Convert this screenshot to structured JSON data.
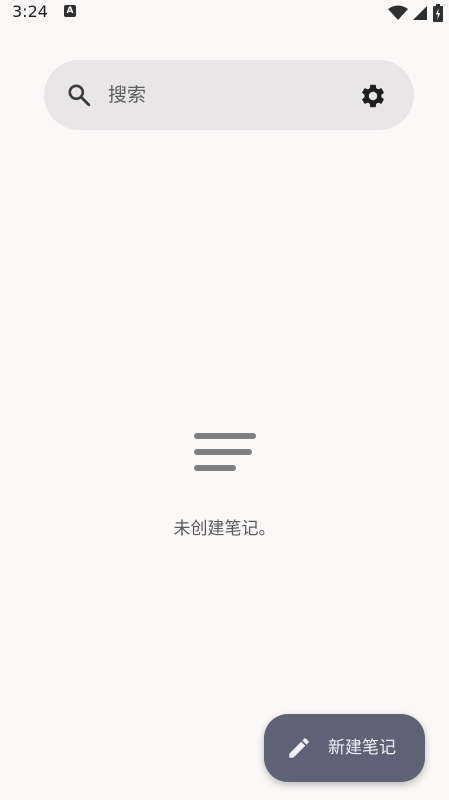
{
  "status_bar": {
    "time": "3:24",
    "notification_icon": "text-app-icon",
    "notification_letter": "A",
    "icons": [
      "wifi-icon",
      "signal-icon",
      "battery-charging-icon"
    ]
  },
  "search": {
    "placeholder": "搜索",
    "icon": "search-icon",
    "settings_icon": "gear-icon"
  },
  "empty_state": {
    "icon": "notes-lines-icon",
    "message": "未创建笔记。"
  },
  "fab": {
    "icon": "pencil-icon",
    "label": "新建笔记"
  },
  "colors": {
    "background": "#fbf8f8",
    "search_bar": "#e8e6e6",
    "fab": "#5f6175",
    "fab_text": "#f1f0f5",
    "icon_gray": "#808080"
  }
}
